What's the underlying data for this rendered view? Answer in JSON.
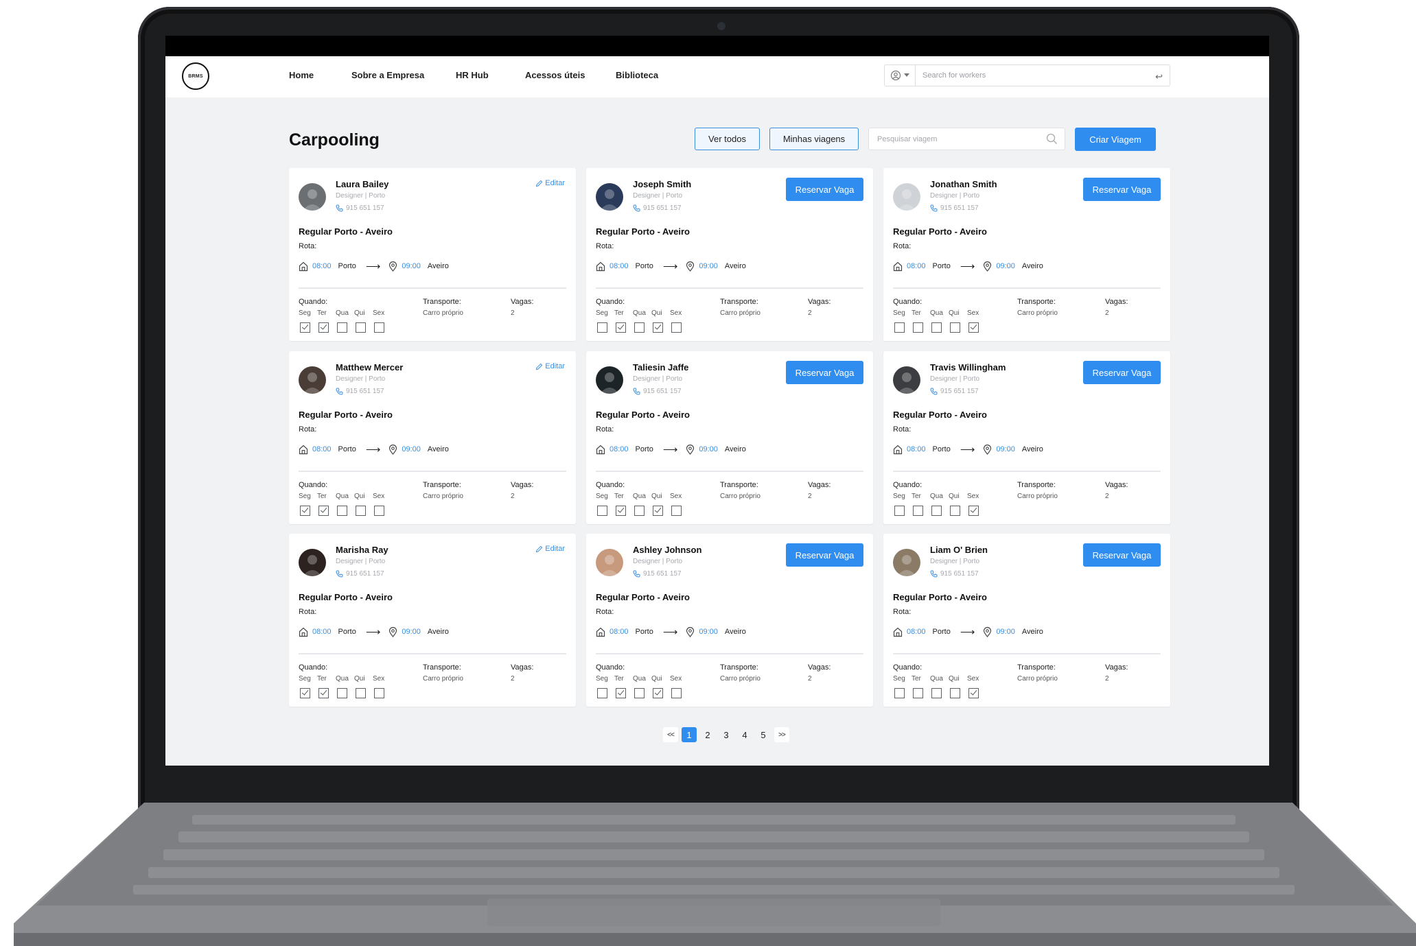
{
  "brand": {
    "logo_text": "BRMS"
  },
  "nav": {
    "items": [
      "Home",
      "Sobre a Empresa",
      "HR Hub",
      "Acessos úteis",
      "Biblioteca"
    ]
  },
  "worker_search": {
    "placeholder": "Search for workers"
  },
  "page": {
    "title": "Carpooling",
    "view_all_label": "Ver todos",
    "my_trips_label": "Minhas viagens",
    "trip_search_placeholder": "Pesquisar viagem",
    "create_trip_label": "Criar Viagem"
  },
  "labels": {
    "edit": "Editar",
    "reserve": "Reservar Vaga",
    "rota": "Rota:",
    "when": "Quando:",
    "transport": "Transporte:",
    "seats": "Vagas:",
    "days": [
      "Seg",
      "Ter",
      "Qua",
      "Qui",
      "Sex"
    ]
  },
  "colors": {
    "accent": "#2f8df0",
    "page_bg": "#f1f2f4",
    "card_bg": "#ffffff"
  },
  "cards": [
    {
      "name": "Laura Bailey",
      "role": "Designer | Porto",
      "phone": "915 651 157",
      "own": true,
      "route_title": "Regular Porto - Aveiro",
      "depart_time": "08:00",
      "from": "Porto",
      "arrive_time": "09:00",
      "to": "Aveiro",
      "transport": "Carro próprio",
      "seats": "2",
      "days_checked": [
        true,
        true,
        false,
        false,
        false
      ],
      "avatar_color": "#6b6f72"
    },
    {
      "name": "Joseph Smith",
      "role": "Designer | Porto",
      "phone": "915 651 157",
      "own": false,
      "route_title": "Regular Porto - Aveiro",
      "depart_time": "08:00",
      "from": "Porto",
      "arrive_time": "09:00",
      "to": "Aveiro",
      "transport": "Carro próprio",
      "seats": "2",
      "days_checked": [
        false,
        true,
        false,
        true,
        false
      ],
      "avatar_color": "#2a3a5a"
    },
    {
      "name": "Jonathan Smith",
      "role": "Designer | Porto",
      "phone": "915 651 157",
      "own": false,
      "route_title": "Regular Porto - Aveiro",
      "depart_time": "08:00",
      "from": "Porto",
      "arrive_time": "09:00",
      "to": "Aveiro",
      "transport": "Carro próprio",
      "seats": "2",
      "days_checked": [
        false,
        false,
        false,
        false,
        true
      ],
      "avatar_color": "#cfd2d6"
    },
    {
      "name": "Matthew Mercer",
      "role": "Designer | Porto",
      "phone": "915 651 157",
      "own": true,
      "route_title": "Regular Porto - Aveiro",
      "depart_time": "08:00",
      "from": "Porto",
      "arrive_time": "09:00",
      "to": "Aveiro",
      "transport": "Carro próprio",
      "seats": "2",
      "days_checked": [
        true,
        true,
        false,
        false,
        false
      ],
      "avatar_color": "#4a3c36"
    },
    {
      "name": "Taliesin Jaffe",
      "role": "Designer | Porto",
      "phone": "915 651 157",
      "own": false,
      "route_title": "Regular Porto - Aveiro",
      "depart_time": "08:00",
      "from": "Porto",
      "arrive_time": "09:00",
      "to": "Aveiro",
      "transport": "Carro próprio",
      "seats": "2",
      "days_checked": [
        false,
        true,
        false,
        true,
        false
      ],
      "avatar_color": "#1d2428"
    },
    {
      "name": "Travis Willingham",
      "role": "Designer | Porto",
      "phone": "915 651 157",
      "own": false,
      "route_title": "Regular Porto - Aveiro",
      "depart_time": "08:00",
      "from": "Porto",
      "arrive_time": "09:00",
      "to": "Aveiro",
      "transport": "Carro próprio",
      "seats": "2",
      "days_checked": [
        false,
        false,
        false,
        false,
        true
      ],
      "avatar_color": "#3b3d40"
    },
    {
      "name": "Marisha Ray",
      "role": "Designer | Porto",
      "phone": "915 651 157",
      "own": true,
      "route_title": "Regular Porto - Aveiro",
      "depart_time": "08:00",
      "from": "Porto",
      "arrive_time": "09:00",
      "to": "Aveiro",
      "transport": "Carro próprio",
      "seats": "2",
      "days_checked": [
        true,
        true,
        false,
        false,
        false
      ],
      "avatar_color": "#2c2220"
    },
    {
      "name": "Ashley Johnson",
      "role": "Designer | Porto",
      "phone": "915 651 157",
      "own": false,
      "route_title": "Regular Porto - Aveiro",
      "depart_time": "08:00",
      "from": "Porto",
      "arrive_time": "09:00",
      "to": "Aveiro",
      "transport": "Carro próprio",
      "seats": "2",
      "days_checked": [
        false,
        true,
        false,
        true,
        false
      ],
      "avatar_color": "#c79a7e"
    },
    {
      "name": "Liam O' Brien",
      "role": "Designer | Porto",
      "phone": "915 651 157",
      "own": false,
      "route_title": "Regular Porto - Aveiro",
      "depart_time": "08:00",
      "from": "Porto",
      "arrive_time": "09:00",
      "to": "Aveiro",
      "transport": "Carro próprio",
      "seats": "2",
      "days_checked": [
        false,
        false,
        false,
        false,
        true
      ],
      "avatar_color": "#8a7a66"
    }
  ],
  "pagination": {
    "prev_label": "<<",
    "next_label": ">>",
    "pages": [
      "1",
      "2",
      "3",
      "4",
      "5"
    ],
    "current": "1"
  }
}
